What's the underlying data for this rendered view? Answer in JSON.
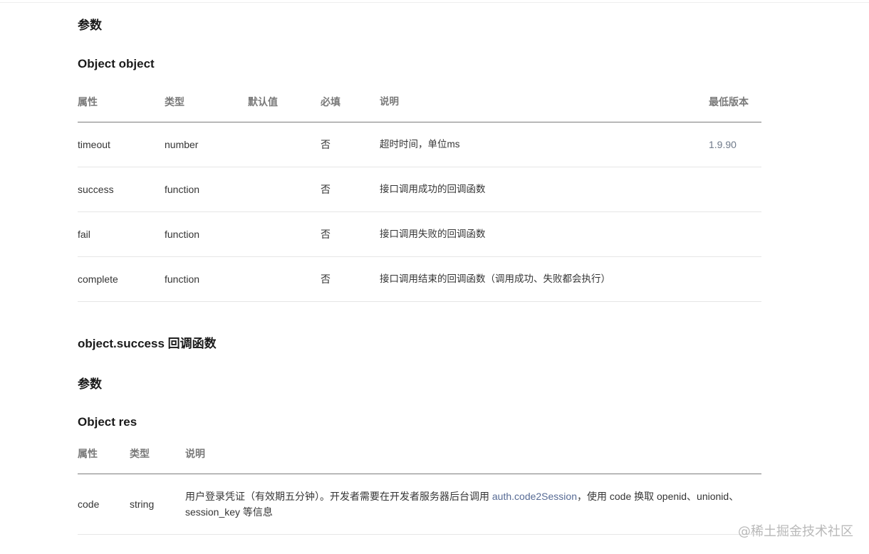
{
  "section1": {
    "heading": "参数",
    "object_title": "Object object"
  },
  "table1": {
    "headers": [
      "属性",
      "类型",
      "默认值",
      "必填",
      "说明",
      "最低版本"
    ],
    "rows": [
      {
        "name": "timeout",
        "type": "number",
        "default": "",
        "required": "否",
        "desc": "超时时间，单位ms",
        "version": "1.9.90"
      },
      {
        "name": "success",
        "type": "function",
        "default": "",
        "required": "否",
        "desc": "接口调用成功的回调函数",
        "version": ""
      },
      {
        "name": "fail",
        "type": "function",
        "default": "",
        "required": "否",
        "desc": "接口调用失败的回调函数",
        "version": ""
      },
      {
        "name": "complete",
        "type": "function",
        "default": "",
        "required": "否",
        "desc": "接口调用结束的回调函数（调用成功、失败都会执行）",
        "version": ""
      }
    ]
  },
  "section2": {
    "callback_title": "object.success 回调函数",
    "heading": "参数",
    "object_title": "Object res"
  },
  "table2": {
    "headers": [
      "属性",
      "类型",
      "说明"
    ],
    "rows": [
      {
        "name": "code",
        "type": "string",
        "desc_before": "用户登录凭证（有效期五分钟）。开发者需要在开发者服务器后台调用 ",
        "desc_link": "auth.code2Session",
        "desc_after": "，使用 code 换取 openid、unionid、session_key 等信息"
      }
    ]
  },
  "watermark": "@稀土掘金技术社区"
}
